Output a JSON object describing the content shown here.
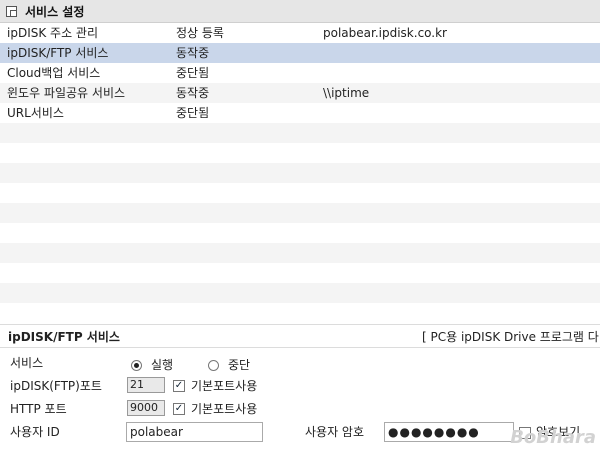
{
  "title": "서비스 설정",
  "services": [
    {
      "name": "ipDISK 주소 관리",
      "status": "정상 등록",
      "detail": "polabear.ipdisk.co.kr"
    },
    {
      "name": "ipDISK/FTP 서비스",
      "status": "동작중",
      "detail": ""
    },
    {
      "name": "Cloud백업 서비스",
      "status": "중단됨",
      "detail": ""
    },
    {
      "name": "윈도우 파일공유 서비스",
      "status": "동작중",
      "detail": "\\\\iptime"
    },
    {
      "name": "URL서비스",
      "status": "중단됨",
      "detail": ""
    }
  ],
  "panel": {
    "title": "ipDISK/FTP 서비스",
    "note": "[ PC용 ipDISK Drive 프로그램 다",
    "service_label": "서비스",
    "run_label": "실행",
    "stop_label": "중단",
    "run_selected": true,
    "ftp_port_label": "ipDISK(FTP)포트",
    "ftp_port_value": "21",
    "default_port_label": "기본포트사용",
    "http_port_label": "HTTP 포트",
    "http_port_value": "9000",
    "user_id_label": "사용자 ID",
    "user_id_value": "polabear",
    "password_label": "사용자 암호",
    "password_value": "●●●●●●●●",
    "show_password_label": "암호보기"
  },
  "watermark": "BoBhara"
}
